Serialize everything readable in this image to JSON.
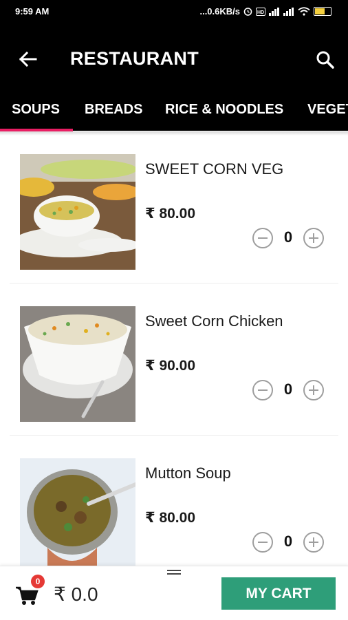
{
  "status_bar": {
    "time": "9:59 AM",
    "network_speed": "...0.6KB/s",
    "icons": [
      "alarm-icon",
      "hd-icon",
      "signal-icon",
      "wifi-icon",
      "battery-icon"
    ]
  },
  "app_bar": {
    "back_icon": "arrow-left-icon",
    "title": "RESTAURANT",
    "search_icon": "search-icon"
  },
  "tabs": [
    {
      "label": "SOUPS",
      "selected": true
    },
    {
      "label": "BREADS",
      "selected": false
    },
    {
      "label": "RICE & NOODLES",
      "selected": false
    },
    {
      "label": "VEGET",
      "selected": false
    }
  ],
  "items": [
    {
      "name": "SWEET CORN VEG",
      "price": "₹ 80.00",
      "quantity": "0"
    },
    {
      "name": "Sweet Corn Chicken",
      "price": "₹ 90.00",
      "quantity": "0"
    },
    {
      "name": "Mutton Soup",
      "price": "₹ 80.00",
      "quantity": "0"
    }
  ],
  "bottom_bar": {
    "cart_badge": "0",
    "total": "₹ 0.0",
    "cart_button": "MY CART"
  },
  "colors": {
    "header": "#000000",
    "tab_indicator": "#e91e63",
    "cart_button": "#2e9e79",
    "badge": "#e53935"
  }
}
